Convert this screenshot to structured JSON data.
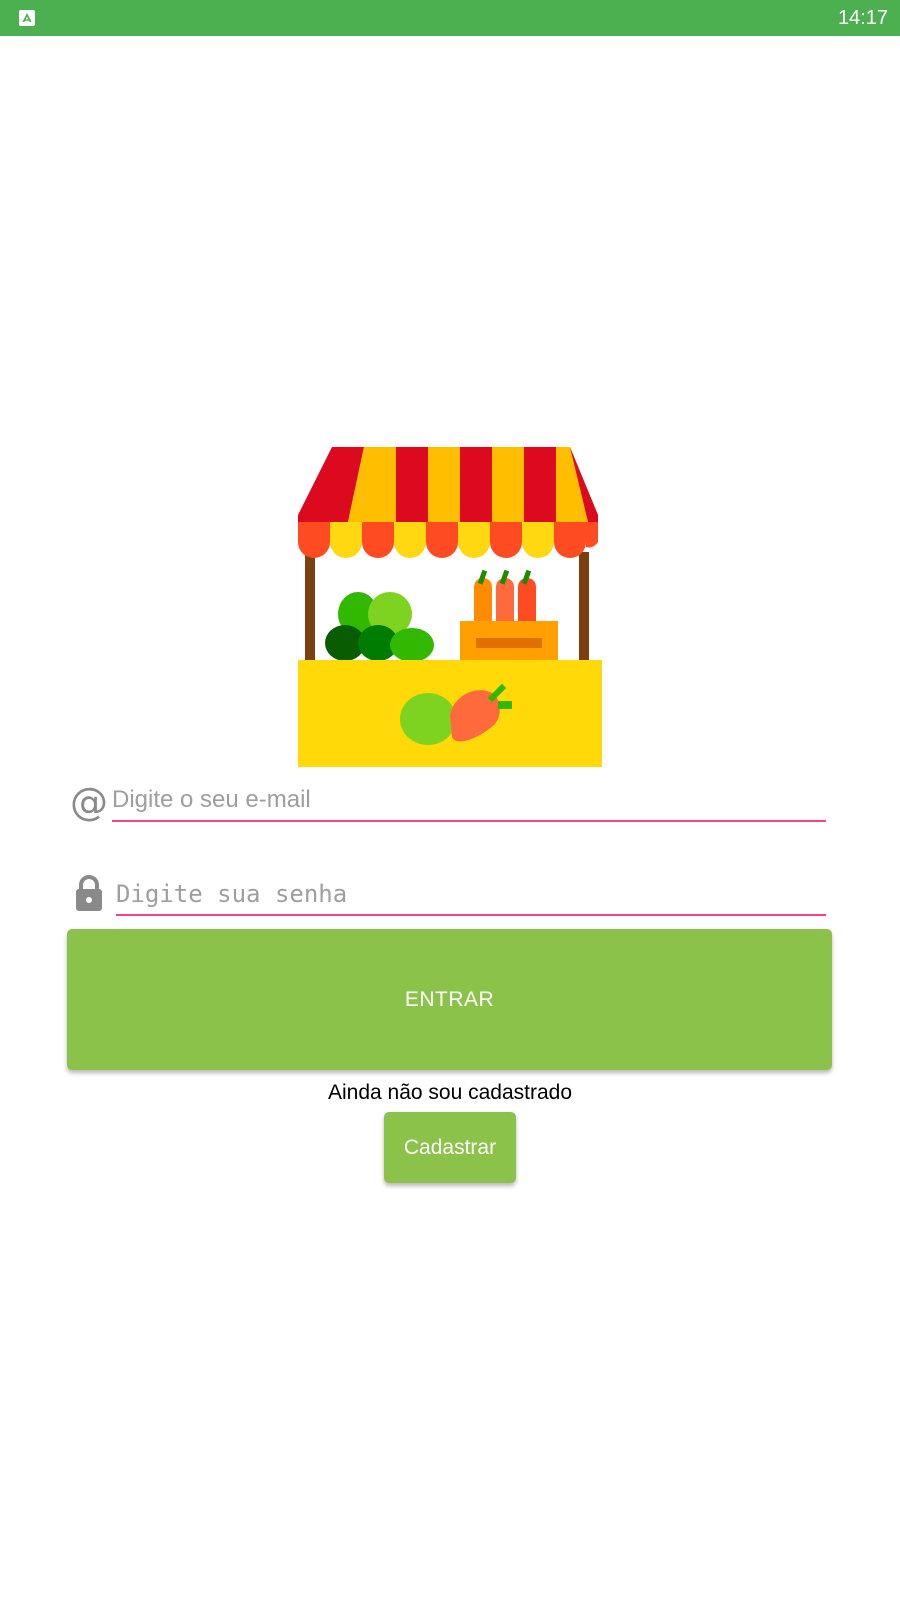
{
  "status_bar": {
    "time": "14:17",
    "app_icon": "app-store-icon",
    "background": "#4caf50"
  },
  "illustration": {
    "name": "market-stall-illustration"
  },
  "login_form": {
    "email": {
      "icon": "at-sign-icon",
      "icon_glyph": "@",
      "placeholder": "Digite o seu e-mail",
      "value": ""
    },
    "password": {
      "icon": "lock-icon",
      "placeholder": "Digite sua senha",
      "value": ""
    },
    "underline_color": "#ff4081",
    "login_button_label": "ENTRAR",
    "not_registered_text": "Ainda não sou cadastrado",
    "register_button_label": "Cadastrar",
    "button_color": "#8bc34a"
  }
}
